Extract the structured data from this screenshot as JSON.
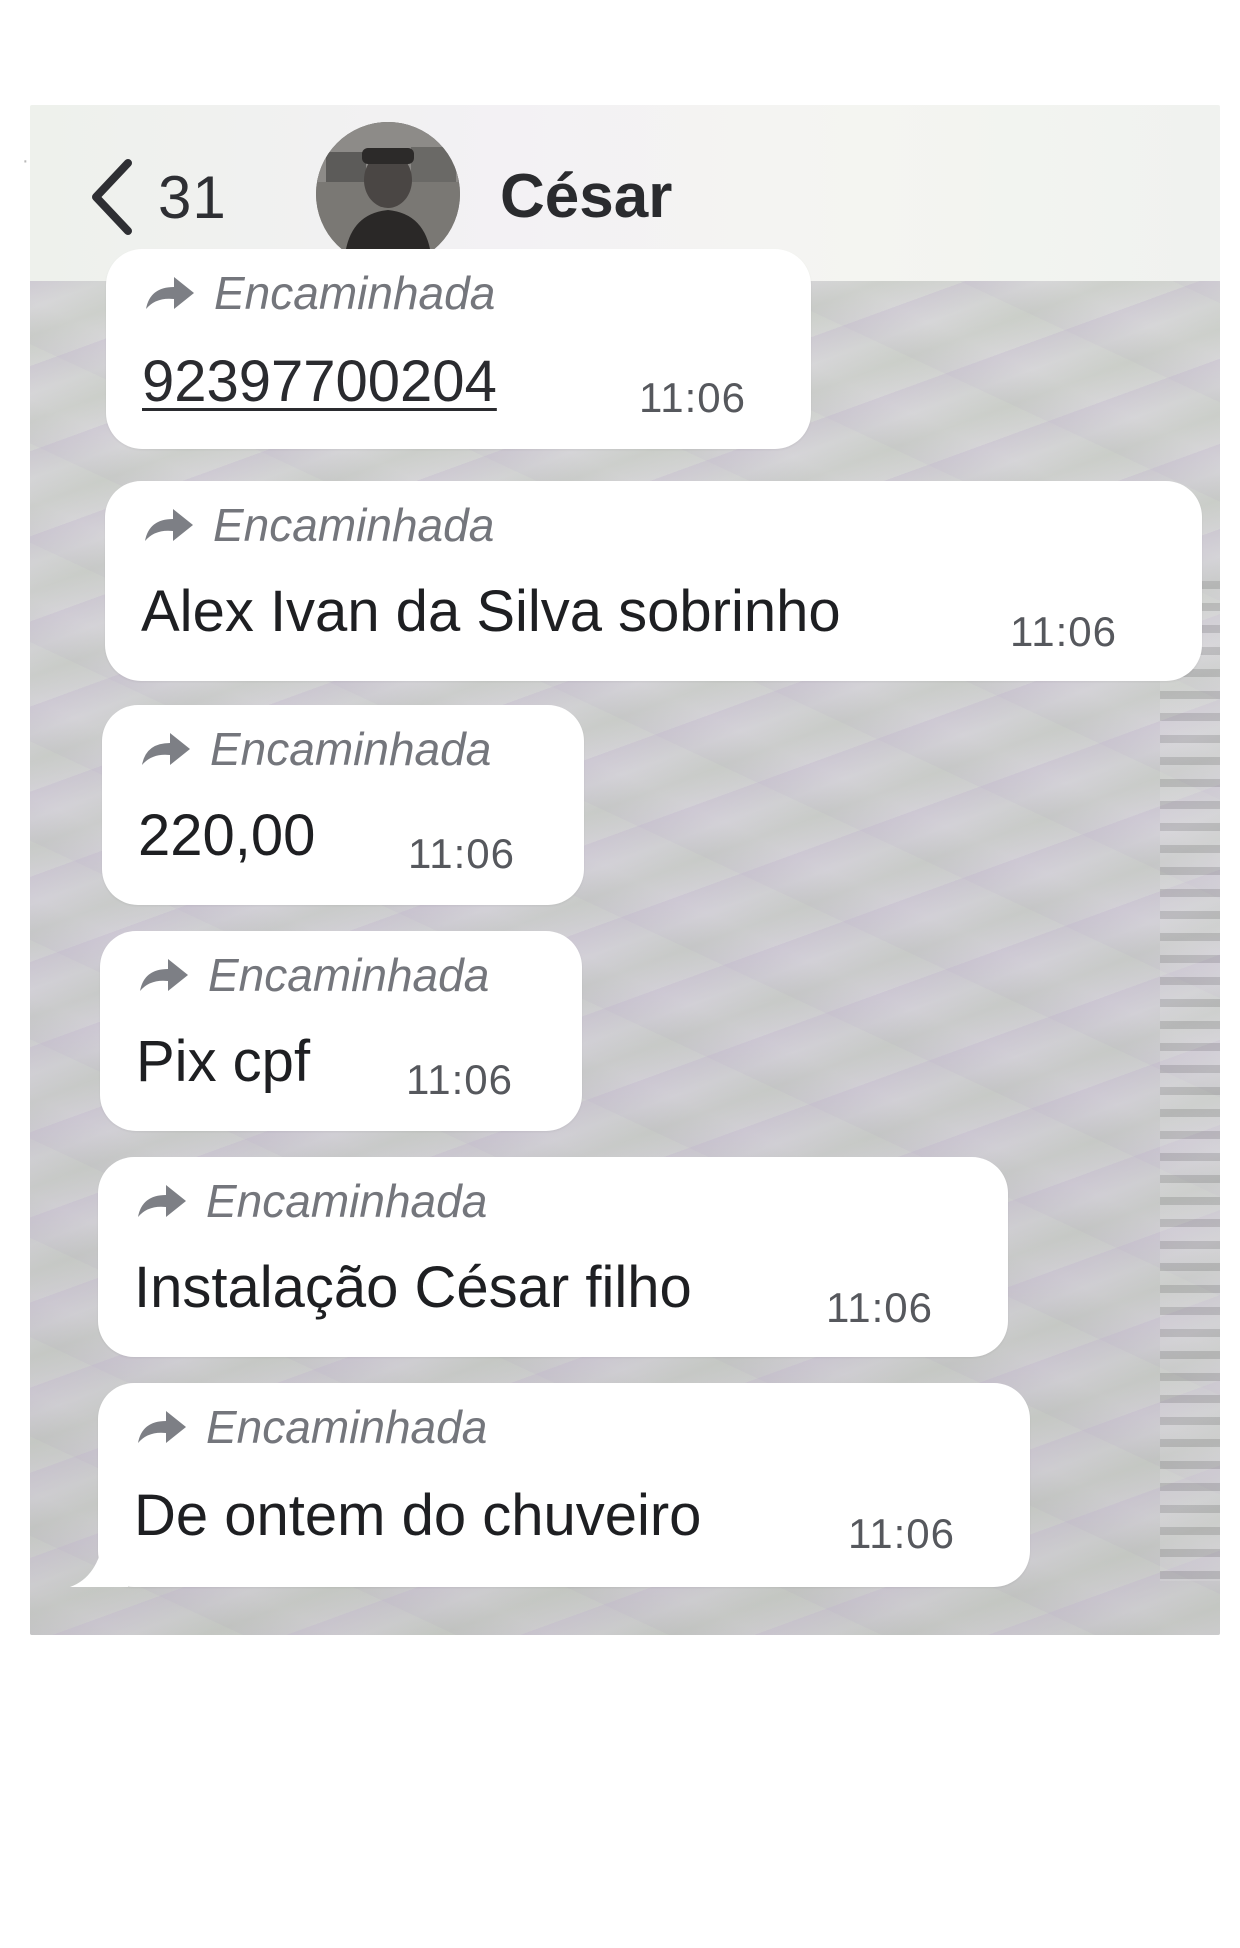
{
  "header": {
    "back_count": "31",
    "contact_name": "César"
  },
  "messages": [
    {
      "forwarded_label": "Encaminhada",
      "text": "92397700204",
      "time": "11:06",
      "is_link": true
    },
    {
      "forwarded_label": "Encaminhada",
      "text": "Alex Ivan da Silva sobrinho",
      "time": "11:06",
      "is_link": false
    },
    {
      "forwarded_label": "Encaminhada",
      "text": "220,00",
      "time": "11:06",
      "is_link": false
    },
    {
      "forwarded_label": "Encaminhada",
      "text": "Pix cpf",
      "time": "11:06",
      "is_link": false
    },
    {
      "forwarded_label": "Encaminhada",
      "text": "Instalação César filho",
      "time": "11:06",
      "is_link": false
    },
    {
      "forwarded_label": "Encaminhada",
      "text": "De ontem do chuveiro",
      "time": "11:06",
      "is_link": false
    }
  ],
  "icons": {
    "back": "chevron-left-icon",
    "forward": "forward-arrow-icon",
    "avatar": "contact-avatar"
  },
  "colors": {
    "bubble": "#ffffff",
    "text": "#1e1f22",
    "forwarded_label": "#74767c",
    "timestamp": "#56585d"
  }
}
